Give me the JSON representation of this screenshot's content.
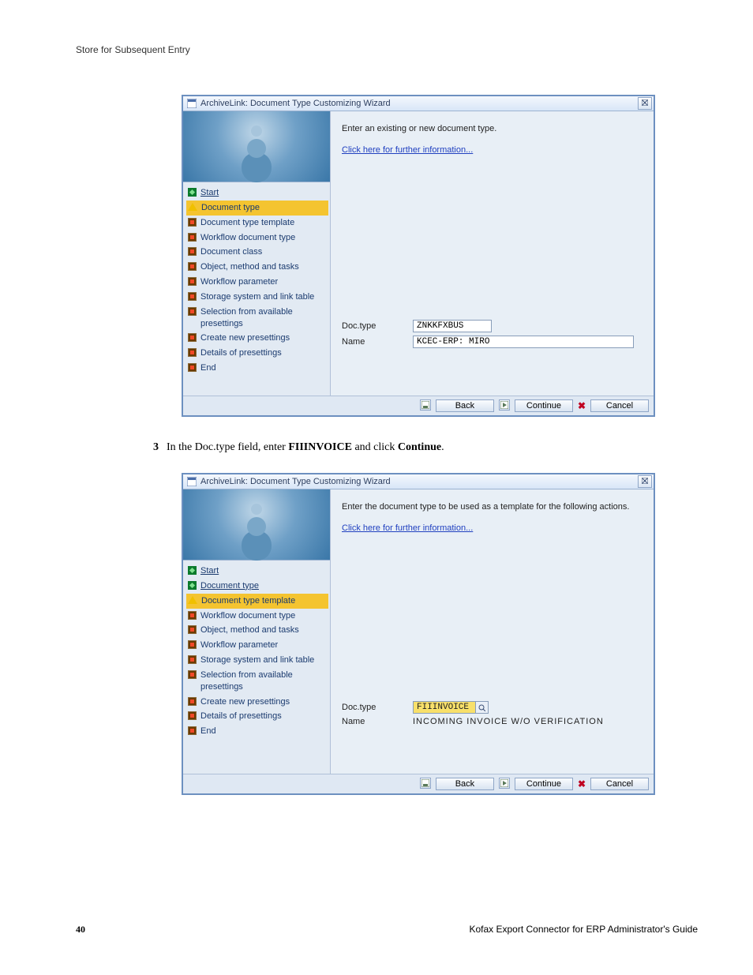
{
  "page": {
    "header": "Store for Subsequent Entry",
    "number": "40",
    "guide_title": "Kofax Export Connector for ERP Administrator's Guide"
  },
  "step": {
    "num": "3",
    "pre": "In the Doc.type field, enter ",
    "bold1": "FIIINVOICE",
    "mid": " and click ",
    "bold2": "Continue",
    "post": "."
  },
  "win1": {
    "title": "ArchiveLink: Document Type Customizing Wizard",
    "instr": "Enter an existing or new document type.",
    "link": "Click here for further information...",
    "nav": [
      {
        "label": "Start",
        "state": "done",
        "link": true
      },
      {
        "label": "Document type",
        "state": "current"
      },
      {
        "label": "Document type template",
        "state": "todo"
      },
      {
        "label": "Workflow document type",
        "state": "todo"
      },
      {
        "label": "Document class",
        "state": "todo"
      },
      {
        "label": "Object, method and tasks",
        "state": "todo"
      },
      {
        "label": "Workflow parameter",
        "state": "todo"
      },
      {
        "label": "Storage system and link table",
        "state": "todo"
      },
      {
        "label": "Selection from available presettings",
        "state": "todo"
      },
      {
        "label": "Create new presettings",
        "state": "todo"
      },
      {
        "label": "Details of presettings",
        "state": "todo"
      },
      {
        "label": "End",
        "state": "todo"
      }
    ],
    "doctype_label": "Doc.type",
    "doctype_value": "ZNKKFXBUS",
    "name_label": "Name",
    "name_value": "KCEC-ERP: MIRO",
    "btn_back": "Back",
    "btn_continue": "Continue",
    "btn_cancel": "Cancel"
  },
  "win2": {
    "title": "ArchiveLink: Document Type Customizing Wizard",
    "instr": "Enter the document type to be used as a template for the following actions.",
    "link": "Click here for further information...",
    "nav": [
      {
        "label": "Start",
        "state": "done",
        "link": true
      },
      {
        "label": "Document type",
        "state": "done",
        "link": true
      },
      {
        "label": "Document type template",
        "state": "current"
      },
      {
        "label": "Workflow document type",
        "state": "todo"
      },
      {
        "label": "Object, method and tasks",
        "state": "todo"
      },
      {
        "label": "Workflow parameter",
        "state": "todo"
      },
      {
        "label": "Storage system and link table",
        "state": "todo"
      },
      {
        "label": "Selection from available presettings",
        "state": "todo"
      },
      {
        "label": "Create new presettings",
        "state": "todo"
      },
      {
        "label": "Details of presettings",
        "state": "todo"
      },
      {
        "label": "End",
        "state": "todo"
      }
    ],
    "doctype_label": "Doc.type",
    "doctype_value": "FIIINVOICE",
    "name_label": "Name",
    "name_value": "INCOMING INVOICE W/O VERIFICATION",
    "btn_back": "Back",
    "btn_continue": "Continue",
    "btn_cancel": "Cancel"
  }
}
